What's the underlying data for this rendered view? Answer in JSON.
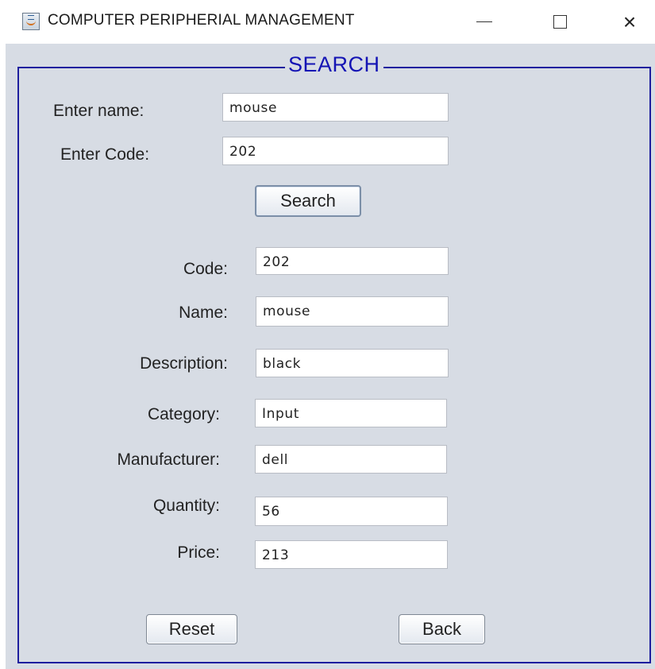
{
  "window": {
    "title": "COMPUTER PERIPHERIAL MANAGEMENT",
    "icon": "java-coffee-cup-icon",
    "controls": {
      "minimize": "minimize-icon",
      "maximize": "maximize-icon",
      "close_glyph": "×"
    }
  },
  "group": {
    "legend": "SEARCH",
    "legend_color": "#1414b4",
    "border_color": "#1e1e9e",
    "background": "#d7dce4"
  },
  "search": {
    "name_label": "Enter name:",
    "name_value": "mouse",
    "code_label": "Enter Code:",
    "code_value": "202",
    "button_label": "Search"
  },
  "details": {
    "code_label": "Code:",
    "code_value": "202",
    "name_label": "Name:",
    "name_value": "mouse",
    "description_label": "Description:",
    "description_value": "black",
    "category_label": "Category:",
    "category_value": "Input",
    "manufacturer_label": "Manufacturer:",
    "manufacturer_value": "dell",
    "quantity_label": "Quantity:",
    "quantity_value": "56",
    "price_label": "Price:",
    "price_value": "213"
  },
  "actions": {
    "reset_label": "Reset",
    "back_label": "Back"
  }
}
